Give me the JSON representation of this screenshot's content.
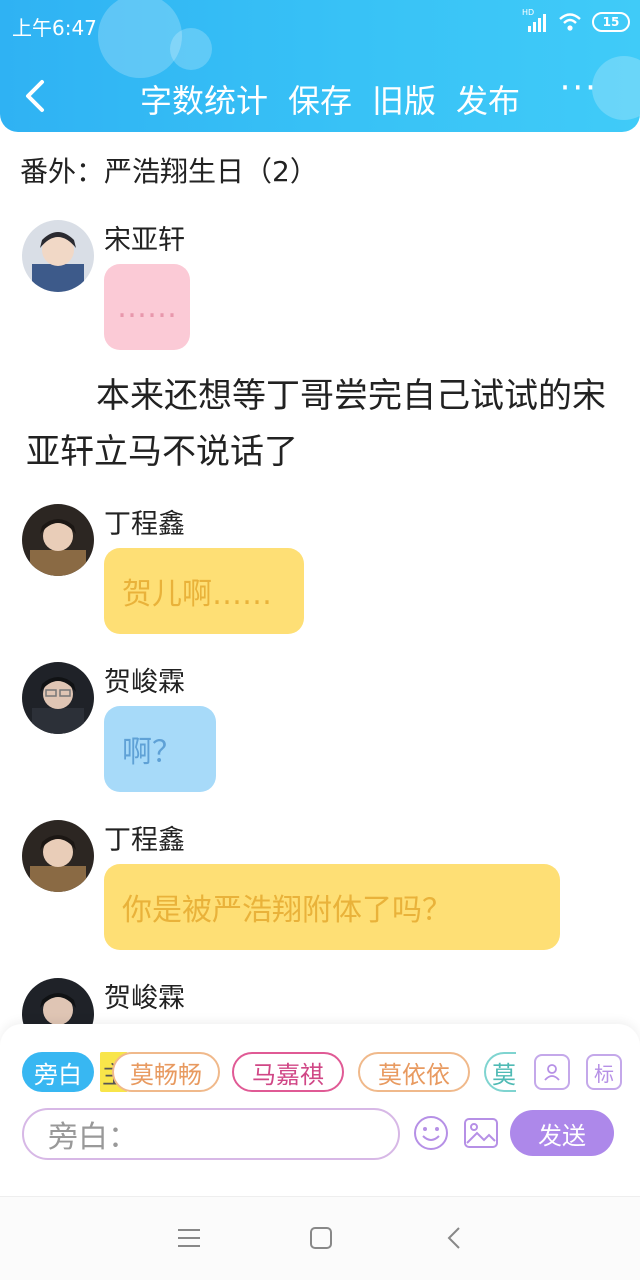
{
  "status_bar": {
    "time": "上午6:47",
    "network": "HD",
    "battery_level": "15"
  },
  "toolbar": {
    "word_count_label": "字数统计",
    "save_label": "保存",
    "old_version_label": "旧版",
    "publish_label": "发布",
    "more_label": "···"
  },
  "chapter": {
    "title": "番外：严浩翔生日（2）"
  },
  "messages": [
    {
      "speaker": "宋亚轩",
      "text": "……",
      "color": "#fbcad6"
    },
    {
      "speaker": "丁程鑫",
      "text": "贺儿啊……",
      "color": "#fedf75"
    },
    {
      "speaker": "贺峻霖",
      "text": "啊？",
      "color": "#a7daf9"
    },
    {
      "speaker": "丁程鑫",
      "text": "你是被严浩翔附体了吗？",
      "color": "#fedf75"
    },
    {
      "speaker": "贺峻霖",
      "text": ""
    }
  ],
  "narration": {
    "text": "本来还想等丁哥尝完自己试试的宋亚轩立马不说话了"
  },
  "role_bar": {
    "chips": [
      {
        "label": "旁白",
        "active": true
      },
      {
        "label": "主",
        "highlight": "#f8e54a"
      },
      {
        "label": "莫畅畅",
        "color": "#f0b98b"
      },
      {
        "label": "马嘉祺",
        "color": "#e05a95"
      },
      {
        "label": "莫依依",
        "color": "#f0b98b"
      },
      {
        "label": "莫",
        "color": "#7fd4d0"
      }
    ],
    "add_role_icon": "add-contact-icon",
    "tag_label": "标"
  },
  "composer": {
    "placeholder": "旁白：",
    "send_label": "发送",
    "emoji_icon": "emoji-icon",
    "image_icon": "image-icon"
  },
  "system_nav": {
    "menu_icon": "menu-icon",
    "home_icon": "home-icon",
    "back_icon": "back-icon"
  }
}
